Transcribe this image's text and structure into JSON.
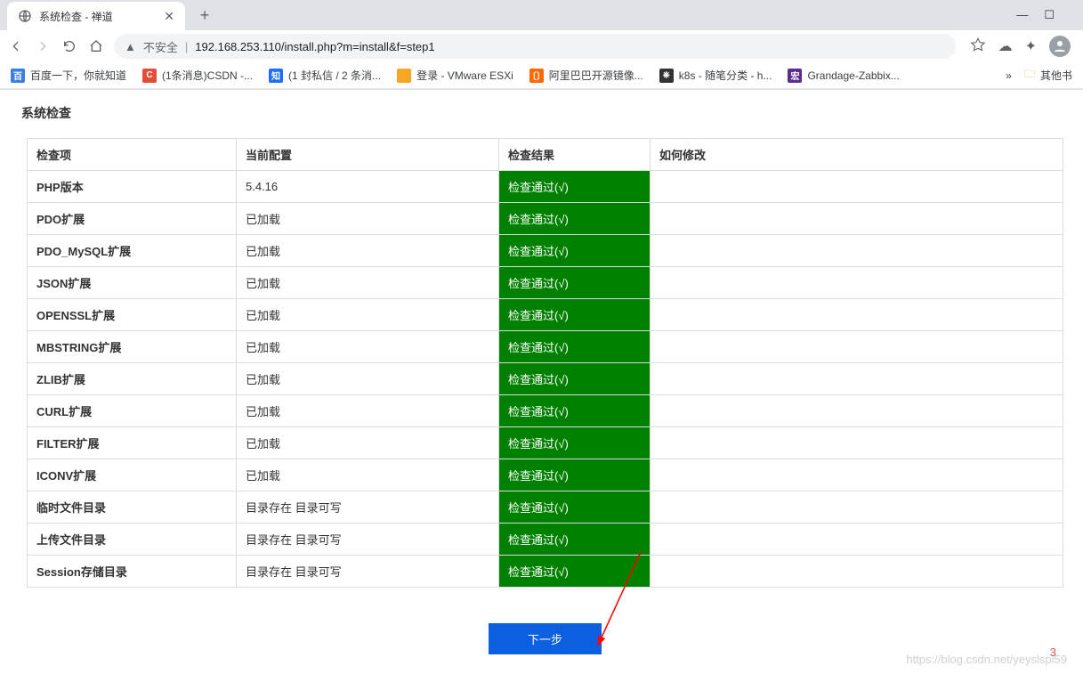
{
  "window": {
    "tab_title": "系统检查 - 禅道",
    "minimize": "—",
    "maximize": "☐",
    "close": ""
  },
  "nav": {
    "insecure_label": "不安全",
    "url": "192.168.253.110/install.php?m=install&f=step1"
  },
  "bookmarks": [
    {
      "icon_bg": "#3b7de0",
      "icon_text": "百",
      "label": "百度一下，你就知道"
    },
    {
      "icon_bg": "#e44d3a",
      "icon_text": "C",
      "label": "(1条消息)CSDN -..."
    },
    {
      "icon_bg": "#1e6fff",
      "icon_text": "知",
      "label": "(1 封私信 / 2 条消..."
    },
    {
      "icon_bg": "#f5a623",
      "icon_text": "",
      "label": "登录 - VMware ESXi"
    },
    {
      "icon_bg": "#ff6a00",
      "icon_text": "〔〕",
      "label": "阿里巴巴开源镜像..."
    },
    {
      "icon_bg": "#333",
      "icon_text": "⎈",
      "label": "k8s - 随笔分类 - h..."
    },
    {
      "icon_bg": "#5b2d90",
      "icon_text": "宏",
      "label": "Grandage-Zabbix..."
    }
  ],
  "bookmarks_more": "»",
  "bookmarks_folder": "其他书",
  "page": {
    "title": "系统检查",
    "headers": {
      "item": "检查项",
      "config": "当前配置",
      "result": "检查结果",
      "fix": "如何修改"
    },
    "pass_label": "检查通过(√)",
    "rows": [
      {
        "item": "PHP版本",
        "config": "5.4.16",
        "fix": ""
      },
      {
        "item": "PDO扩展",
        "config": "已加载",
        "fix": ""
      },
      {
        "item": "PDO_MySQL扩展",
        "config": "已加载",
        "fix": ""
      },
      {
        "item": "JSON扩展",
        "config": "已加载",
        "fix": ""
      },
      {
        "item": "OPENSSL扩展",
        "config": "已加载",
        "fix": ""
      },
      {
        "item": "MBSTRING扩展",
        "config": "已加载",
        "fix": ""
      },
      {
        "item": "ZLIB扩展",
        "config": "已加载",
        "fix": ""
      },
      {
        "item": "CURL扩展",
        "config": "已加载",
        "fix": ""
      },
      {
        "item": "FILTER扩展",
        "config": "已加载",
        "fix": ""
      },
      {
        "item": "ICONV扩展",
        "config": "已加载",
        "fix": ""
      },
      {
        "item": "临时文件目录",
        "config": "目录存在 目录可写",
        "fix": ""
      },
      {
        "item": "上传文件目录",
        "config": "目录存在 目录可写",
        "fix": ""
      },
      {
        "item": "Session存储目录",
        "config": "目录存在 目录可写",
        "fix": ""
      }
    ],
    "next_button": "下一步"
  },
  "watermark": "https://blog.csdn.net/yeyslspi59",
  "badge": "3"
}
